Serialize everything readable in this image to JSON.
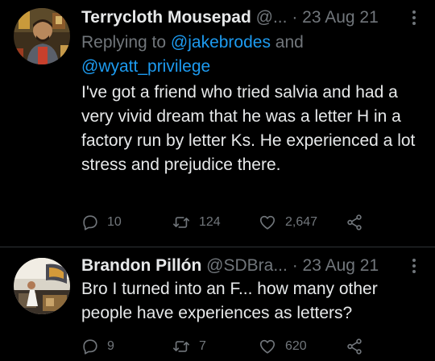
{
  "colors": {
    "background": "#000000",
    "text": "#e7e9ea",
    "muted": "#71767b",
    "link": "#1d9bf0",
    "divider": "#2f3336"
  },
  "tweets": [
    {
      "display_name": "Terrycloth Mousepad",
      "handle": "@...",
      "separator": "·",
      "time": "23 Aug 21",
      "more_icon": "more-vertical-icon",
      "reply_prefix": "Replying to ",
      "reply_mention_1": "@jakebrodes",
      "reply_joiner": " and ",
      "reply_mention_2": "@wyatt_privilege",
      "text": "I've got a friend who tried salvia and had a very vivid dream that he was a letter H in a factory run by letter Ks. He experienced a lot stress and prejudice there.",
      "replies": "10",
      "retweets": "124",
      "likes": "2,647"
    },
    {
      "display_name": "Brandon Pillón",
      "handle": "@SDBra...",
      "separator": "·",
      "time": "23 Aug 21",
      "more_icon": "more-vertical-icon",
      "text": "Bro I turned into an F... how many other people have experiences as letters?",
      "replies": "9",
      "retweets": "7",
      "likes": "620"
    }
  ]
}
